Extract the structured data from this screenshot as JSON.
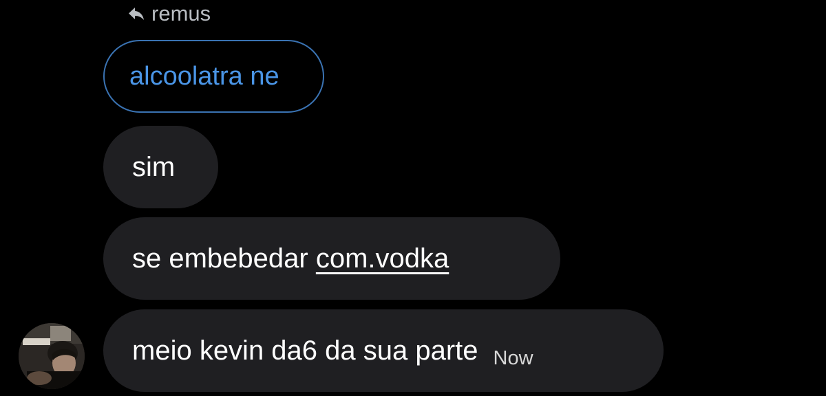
{
  "reply": {
    "icon": "reply-arrow-icon",
    "to": "remus"
  },
  "quoted_message": {
    "text": "alcoolatra ne",
    "border_color": "#3a73b3",
    "text_color": "#4a95e6"
  },
  "messages": [
    {
      "text": "sim"
    },
    {
      "text_before": "se embebedar ",
      "link_text": "com.vodka"
    },
    {
      "text": "meio kevin da6 da sua parte",
      "timestamp": "Now"
    }
  ],
  "avatar": {
    "icon": "avatar-photo"
  },
  "colors": {
    "background": "#000000",
    "bubble": "#1f1f22",
    "text": "#ffffff",
    "secondary_text": "#b9bdc2"
  }
}
